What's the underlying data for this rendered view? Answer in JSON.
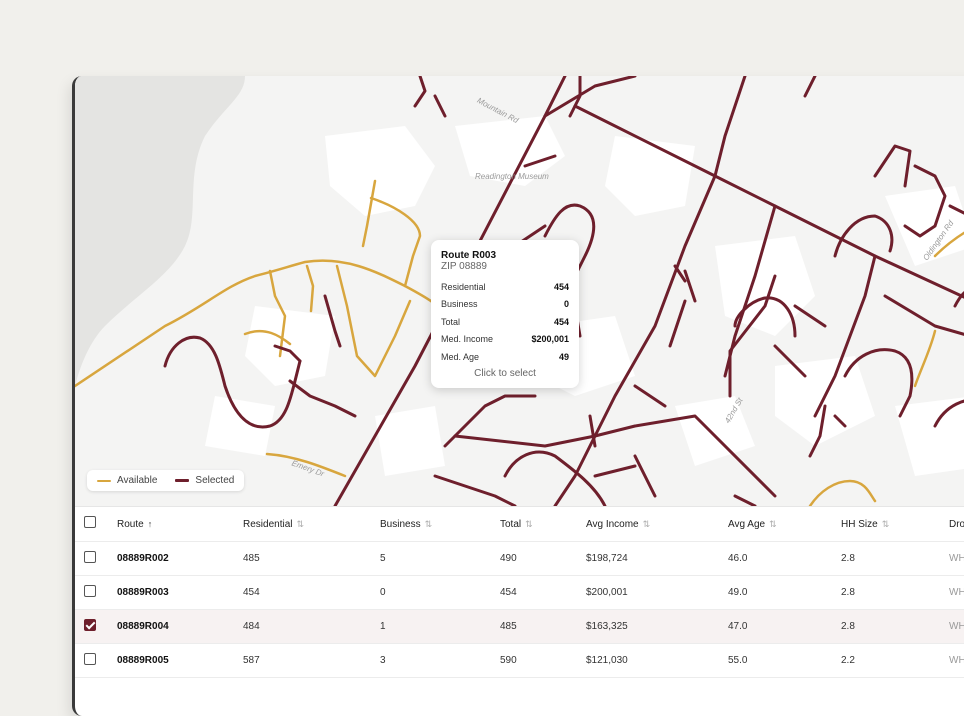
{
  "map": {
    "labels": {
      "mountain_rd": "Mountain Rd",
      "museum": "Readington Museum",
      "st_42": "42nd St",
      "emery": "Emery Dr",
      "oldington": "Oldington Rd"
    },
    "legend": {
      "available": "Available",
      "selected": "Selected"
    },
    "colors": {
      "available": "#d8a63e",
      "selected": "#6e1f2c",
      "water": "#e4e4e2",
      "blocks": "#ffffff",
      "land": "#f4f4f3"
    }
  },
  "tooltip": {
    "title": "Route R003",
    "zip": "ZIP 08889",
    "rows": [
      {
        "label": "Residential",
        "value": "454"
      },
      {
        "label": "Business",
        "value": "0"
      },
      {
        "label": "Total",
        "value": "454"
      },
      {
        "label": "Med. Income",
        "value": "$200,001"
      },
      {
        "label": "Med. Age",
        "value": "49"
      }
    ],
    "hint": "Click to select"
  },
  "table": {
    "headers": {
      "route": "Route",
      "route_sort": "↑",
      "residential": "Residential",
      "business": "Business",
      "total": "Total",
      "avg_income": "Avg Income",
      "avg_age": "Avg Age",
      "hh_size": "HH Size",
      "drop": "Dro",
      "sort": "⇅"
    },
    "rows": [
      {
        "route": "08889R002",
        "residential": "485",
        "business": "5",
        "total": "490",
        "income": "$198,724",
        "age": "46.0",
        "hh": "2.8",
        "drop": "WH",
        "checked": false
      },
      {
        "route": "08889R003",
        "residential": "454",
        "business": "0",
        "total": "454",
        "income": "$200,001",
        "age": "49.0",
        "hh": "2.8",
        "drop": "WH",
        "checked": false
      },
      {
        "route": "08889R004",
        "residential": "484",
        "business": "1",
        "total": "485",
        "income": "$163,325",
        "age": "47.0",
        "hh": "2.8",
        "drop": "WH",
        "checked": true
      },
      {
        "route": "08889R005",
        "residential": "587",
        "business": "3",
        "total": "590",
        "income": "$121,030",
        "age": "55.0",
        "hh": "2.2",
        "drop": "WH",
        "checked": false
      }
    ]
  }
}
